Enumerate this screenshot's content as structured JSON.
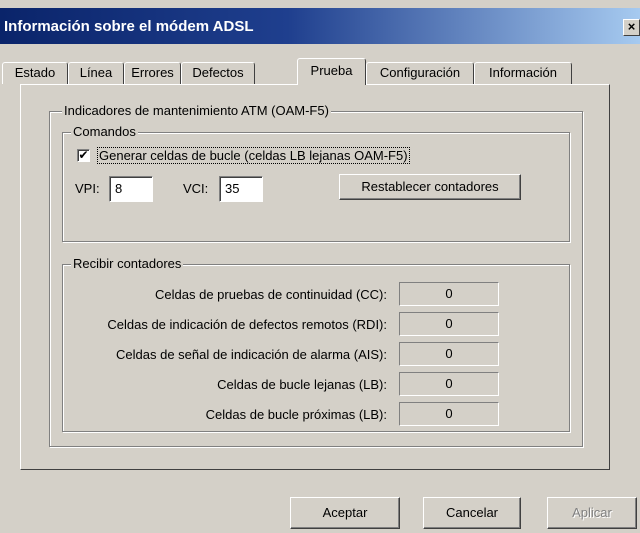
{
  "window": {
    "title": "Información sobre el módem ADSL",
    "close_symbol": "×"
  },
  "tabs": [
    {
      "label": "Estado",
      "active": false
    },
    {
      "label": "Línea",
      "active": false
    },
    {
      "label": "Errores",
      "active": false
    },
    {
      "label": "Defectos",
      "active": false
    },
    {
      "label": "Prueba",
      "active": true
    },
    {
      "label": "Configuración",
      "active": false
    },
    {
      "label": "Información",
      "active": false
    }
  ],
  "oam": {
    "group_label": "Indicadores de mantenimiento ATM (OAM-F5)",
    "commands": {
      "group_label": "Comandos",
      "checkbox_label": "Generar celdas de bucle (celdas LB lejanas OAM-F5)",
      "checkbox_checked": true,
      "checkbox_mark": "✔",
      "vpi_label": "VPI:",
      "vpi_value": "8",
      "vci_label": "VCI:",
      "vci_value": "35",
      "reset_button": "Restablecer contadores"
    },
    "counters": {
      "group_label": "Recibir contadores",
      "rows": [
        {
          "label": "Celdas de pruebas de continuidad (CC):",
          "value": "0"
        },
        {
          "label": "Celdas de indicación de defectos remotos (RDI):",
          "value": "0"
        },
        {
          "label": "Celdas de señal de indicación de alarma (AIS):",
          "value": "0"
        },
        {
          "label": "Celdas de bucle lejanas (LB):",
          "value": "0"
        },
        {
          "label": "Celdas de bucle próximas (LB):",
          "value": "0"
        }
      ]
    }
  },
  "footer": {
    "accept": "Aceptar",
    "cancel": "Cancelar",
    "apply": "Aplicar"
  }
}
